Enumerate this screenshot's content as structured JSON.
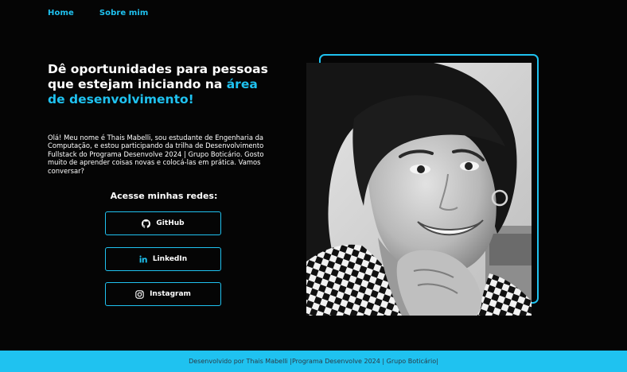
{
  "nav": {
    "home": "Home",
    "about": "Sobre mim"
  },
  "hero": {
    "headline_part1": "Dê oportunidades para pessoas que estejam iniciando na ",
    "headline_accent": "área de desenvolvimento!",
    "intro": "Olá! Meu nome é Thais Mabelli, sou estudante de Engenharia da Computação, e estou participando da trilha de Desenvolvimento Fullstack do Programa Desenvolve 2024 | Grupo Boticário. Gosto muito de aprender coisas novas e colocá-las em prática. Vamos conversar?"
  },
  "social": {
    "title": "Acesse minhas redes:",
    "buttons": [
      {
        "label": "GitHub",
        "icon": "github-icon"
      },
      {
        "label": "LinkedIn",
        "icon": "linkedin-icon"
      },
      {
        "label": "Instagram",
        "icon": "instagram-icon"
      }
    ]
  },
  "photo": {
    "alt": "Foto de Thais Mabelli"
  },
  "footer": {
    "text": "Desenvolvido por Thais Mabelli |Programa Desenvolve 2024 | Grupo Boticário|"
  },
  "colors": {
    "background": "#050505",
    "accent": "#1fc2f0",
    "text": "#ffffff",
    "footer_text": "#2b3a45"
  }
}
